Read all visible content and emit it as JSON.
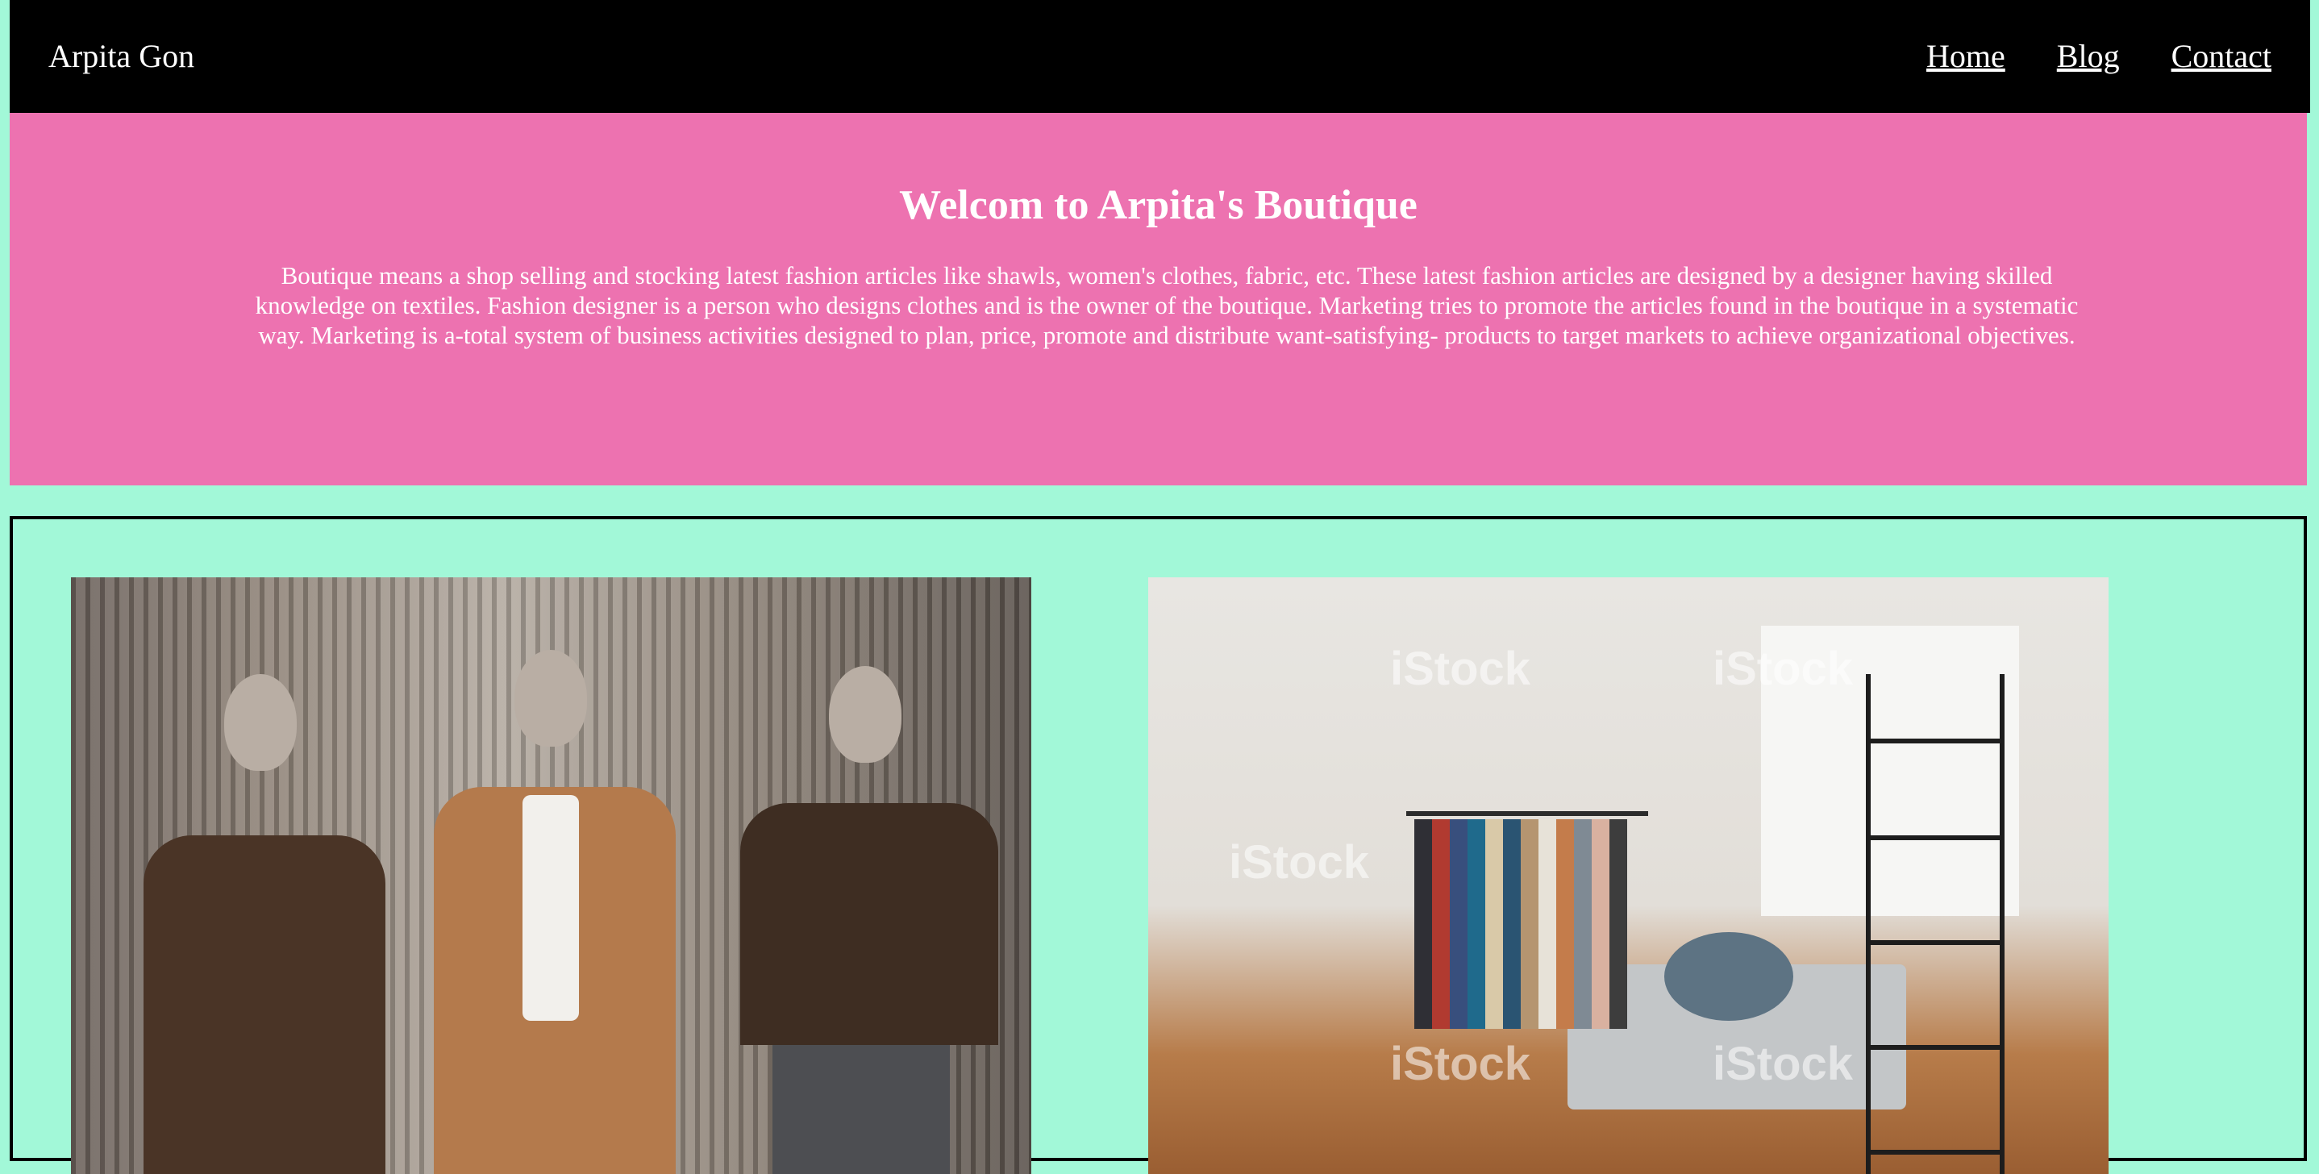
{
  "navbar": {
    "brand": "Arpita Gon",
    "links": [
      {
        "label": "Home"
      },
      {
        "label": "Blog"
      },
      {
        "label": "Contact"
      }
    ]
  },
  "hero": {
    "title": "Welcom to Arpita's Boutique",
    "text": "Boutique means a shop selling and stocking latest fashion articles like shawls, women's clothes, fabric, etc. These latest fashion articles are designed by a designer having skilled knowledge on textiles. Fashion designer is a person who designs clothes and is the owner of the boutique. Marketing tries to promote the articles found in the boutique in a systematic way. Marketing is a-total system of business activities designed to plan, price, promote and distribute want-satisfying- products to target markets to achieve organizational objectives."
  },
  "gallery": {
    "images": [
      {
        "subject": "three mannequins in patterned and suede outfits"
      },
      {
        "subject": "boutique interior with clothing rack and shelves",
        "watermark": "iStock"
      }
    ]
  },
  "colors": {
    "page_background": "#a2f8d8",
    "navbar": "#000000",
    "hero": "#ed72b0"
  }
}
